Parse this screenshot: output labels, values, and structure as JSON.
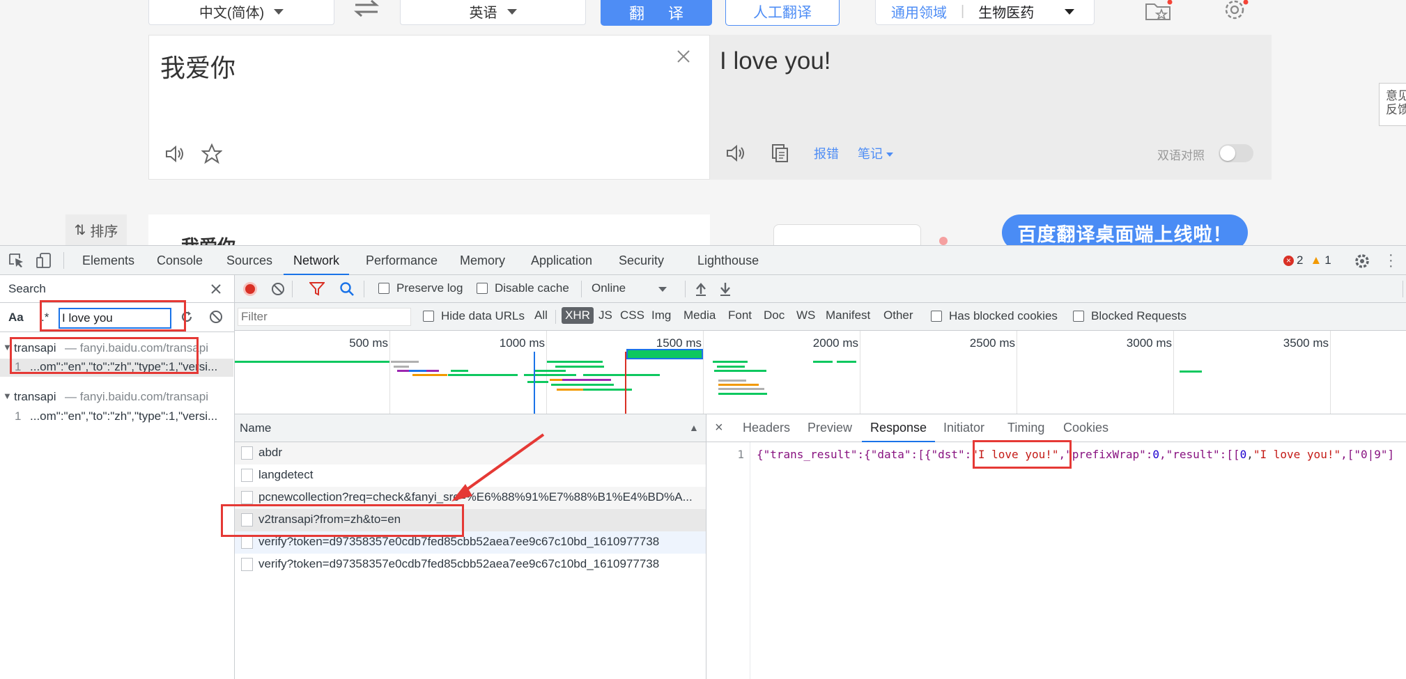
{
  "page": {
    "source_lang": "中文(简体)",
    "target_lang": "英语",
    "translate_button": "翻 译",
    "human_translate_button": "人工翻译",
    "domain_label": "通用领域",
    "domain_value": "生物医药",
    "source_text": "我爱你",
    "result_text": "I love you!",
    "report_error_link": "报错",
    "notes_link": "笔记",
    "bilingual_label": "双语对照",
    "feedback_label": "意见反馈",
    "sort_label": "排序",
    "result_card_title": "我爱你",
    "promo_banner": "百度翻译桌面端上线啦！"
  },
  "devtools": {
    "tabs": [
      "Elements",
      "Console",
      "Sources",
      "Network",
      "Performance",
      "Memory",
      "Application",
      "Security",
      "Lighthouse"
    ],
    "active_tab": "Network",
    "error_count": "2",
    "warning_count": "1",
    "search": {
      "title": "Search",
      "case_toggle": "Aa",
      "regex_toggle": ".*",
      "query": "I love you",
      "results": [
        {
          "file": "transapi",
          "url": "— fanyi.baidu.com/transapi",
          "line_no": "1",
          "snippet": "...om\":\"en\",\"to\":\"zh\",\"type\":1,\"versi..."
        },
        {
          "file": "transapi",
          "url": "— fanyi.baidu.com/transapi",
          "line_no": "1",
          "snippet": "...om\":\"en\",\"to\":\"zh\",\"type\":1,\"versi..."
        }
      ]
    },
    "toolbar": {
      "preserve_log": "Preserve log",
      "disable_cache": "Disable cache",
      "throttling": "Online"
    },
    "filter": {
      "placeholder": "Filter",
      "hide_data_urls": "Hide data URLs",
      "types": [
        "All",
        "XHR",
        "JS",
        "CSS",
        "Img",
        "Media",
        "Font",
        "Doc",
        "WS",
        "Manifest",
        "Other"
      ],
      "active_type": "XHR",
      "has_blocked_cookies": "Has blocked cookies",
      "blocked_requests": "Blocked Requests"
    },
    "timeline_ticks": [
      "500 ms",
      "1000 ms",
      "1500 ms",
      "2000 ms",
      "2500 ms",
      "3000 ms",
      "3500 ms"
    ],
    "requests": {
      "column": "Name",
      "rows": [
        "abdr",
        "langdetect",
        "pcnewcollection?req=check&fanyi_src=%E6%88%91%E7%88%B1%E4%BD%A...",
        "v2transapi?from=zh&to=en",
        "verify?token=d97358357e0cdb7fed85cbb52aea7ee9c67c10bd_1610977738",
        "verify?token=d97358357e0cdb7fed85cbb52aea7ee9c67c10bd_1610977738"
      ]
    },
    "detail": {
      "tabs": [
        "Headers",
        "Preview",
        "Response",
        "Initiator",
        "Timing",
        "Cookies"
      ],
      "active_tab": "Response",
      "line_no": "1",
      "response_parts": {
        "p1": "{\"trans_result\":{\"data\":[{\"dst\":",
        "dst": "\"I love you!\"",
        "p2": ",\"prefixWrap\":",
        "n1": "0",
        "p3": ",\"result\":[[",
        "n2": "0",
        "p4": ",",
        "r1": "\"I love you!\"",
        "p5": ",[\"0|9\"]"
      }
    }
  },
  "colors": {
    "accent_blue": "#4e8df5",
    "devtools_blue": "#1a73e8",
    "annotation_red": "#e53935",
    "record_red": "#d93025"
  }
}
